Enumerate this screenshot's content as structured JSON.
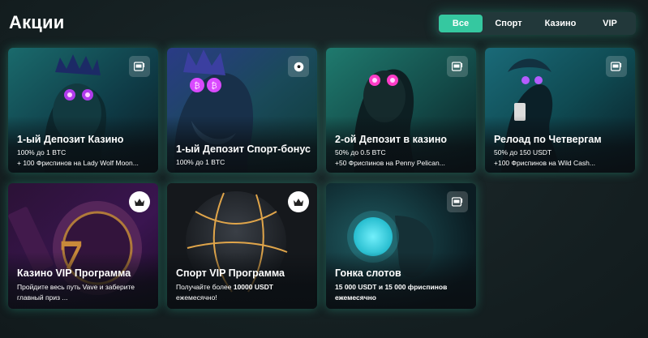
{
  "page": {
    "title": "Акции"
  },
  "filters": {
    "tabs": [
      {
        "label": "Все",
        "active": true
      },
      {
        "label": "Спорт",
        "active": false
      },
      {
        "label": "Казино",
        "active": false
      },
      {
        "label": "VIP",
        "active": false
      }
    ]
  },
  "colors": {
    "accent": "#35c8a0",
    "background": "#162123",
    "glow": "#2dd2aa"
  },
  "promotions": [
    {
      "title": "1-ый Депозит Казино",
      "line1": "100% до 1 BTC",
      "line2": "+ 100 Фриспинов на Lady Wolf Moon...",
      "icon": "slot-machine-icon"
    },
    {
      "title": "1-ый Депозит Спорт-бонус",
      "line1": "100% до 1 BTC",
      "line2": "",
      "icon": "soccer-ball-icon"
    },
    {
      "title": "2-ой Депозит в казино",
      "line1": "50% до 0.5 BTC",
      "line2": "+50 Фриспинов на Penny Pelican...",
      "icon": "slot-machine-icon"
    },
    {
      "title": "Релоад по Четвергам",
      "line1": "50% до 150 USDT",
      "line2": "+100 Фриспинов на Wild Cash...",
      "icon": "slot-machine-icon"
    },
    {
      "title": "Казино VIP Программа",
      "line1": "Пройдите весь путь Vave и заберите",
      "line2": "главный приз ...",
      "icon": "crown-icon"
    },
    {
      "title": "Спорт VIP Программа",
      "line1_pre": "Получайте более ",
      "line1_bold": "10000 USDT",
      "line2": "ежемесячно!",
      "icon": "crown-icon"
    },
    {
      "title": "Гонка слотов",
      "line1": "15 000 USDT и 15 000 фриспинов",
      "line2": "ежемесячно",
      "icon": "slot-machine-icon"
    }
  ]
}
